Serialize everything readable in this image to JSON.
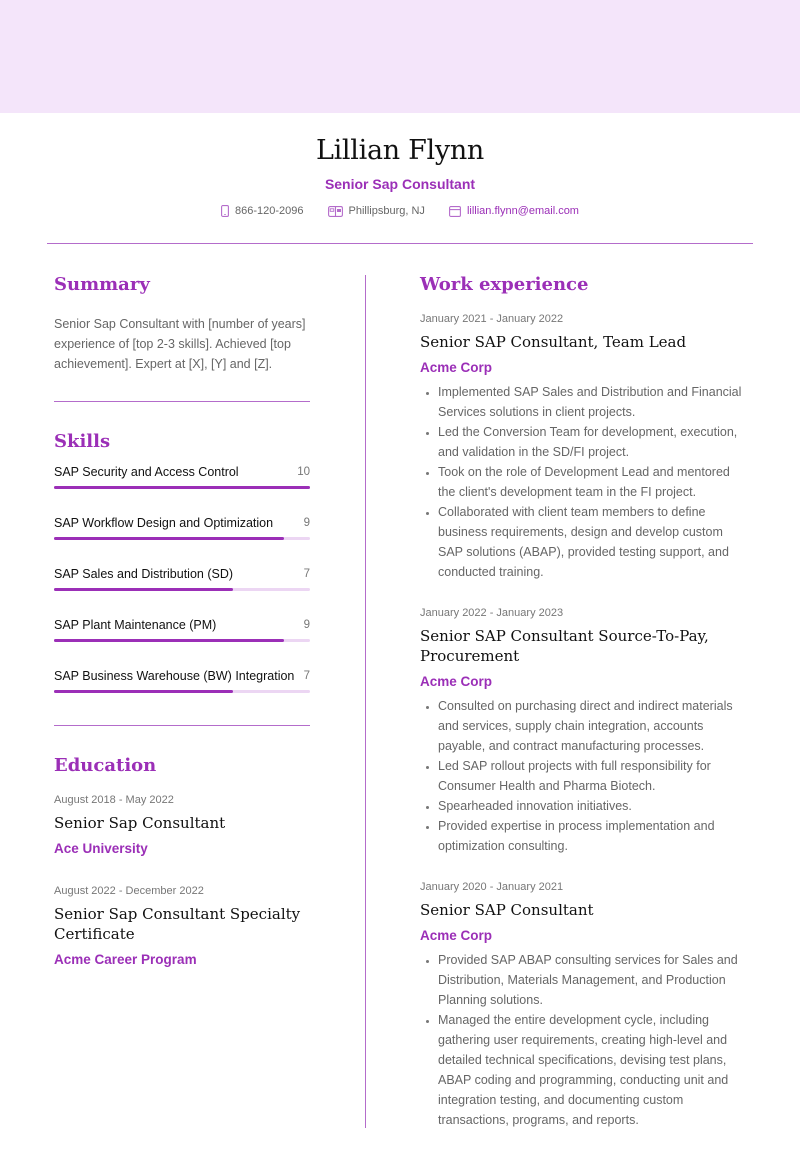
{
  "header": {
    "name": "Lillian Flynn",
    "title": "Senior Sap Consultant",
    "contacts": {
      "phone": "866-120-2096",
      "location": "Phillipsburg, NJ",
      "email": "lillian.flynn@email.com"
    }
  },
  "colors": {
    "accent": "#9b2fb7",
    "band": "#f4e5fa",
    "track": "#ecd6f3"
  },
  "summary": {
    "heading": "Summary",
    "text": "Senior Sap Consultant with [number of years] experience of [top 2-3 skills]. Achieved [top achievement]. Expert at [X], [Y] and [Z]."
  },
  "skills": {
    "heading": "Skills",
    "max": 10,
    "items": [
      {
        "label": "SAP Security and Access Control",
        "value": 10
      },
      {
        "label": "SAP Workflow Design and Optimization",
        "value": 9
      },
      {
        "label": "SAP Sales and Distribution (SD)",
        "value": 7
      },
      {
        "label": "SAP Plant Maintenance (PM)",
        "value": 9
      },
      {
        "label": "SAP Business Warehouse (BW) Integration",
        "value": 7
      }
    ]
  },
  "education": {
    "heading": "Education",
    "items": [
      {
        "dates": "August 2018 - May 2022",
        "degree": "Senior Sap Consultant",
        "school": "Ace University"
      },
      {
        "dates": "August 2022 - December 2022",
        "degree": "Senior Sap Consultant Specialty Certificate",
        "school": "Acme Career Program"
      }
    ]
  },
  "work": {
    "heading": "Work experience",
    "jobs": [
      {
        "dates": "January 2021 - January 2022",
        "role": "Senior SAP Consultant, Team Lead",
        "company": "Acme Corp",
        "bullets": [
          "Implemented SAP Sales and Distribution and Financial Services solutions in client projects.",
          "Led the Conversion Team for development, execution, and validation in the SD/FI project.",
          "Took on the role of Development Lead and mentored the client's development team in the FI project.",
          "Collaborated with client team members to define business requirements, design and develop custom SAP solutions (ABAP), provided testing support, and conducted training."
        ]
      },
      {
        "dates": "January 2022 - January 2023",
        "role": "Senior SAP Consultant Source-To-Pay, Procurement",
        "company": "Acme Corp",
        "bullets": [
          "Consulted on purchasing direct and indirect materials and services, supply chain integration, accounts payable, and contract manufacturing processes.",
          "Led SAP rollout projects with full responsibility for Consumer Health and Pharma Biotech.",
          "Spearheaded innovation initiatives.",
          "Provided expertise in process implementation and optimization consulting."
        ]
      },
      {
        "dates": "January 2020 - January 2021",
        "role": "Senior SAP Consultant",
        "company": "Acme Corp",
        "bullets": [
          "Provided SAP ABAP consulting services for Sales and Distribution, Materials Management, and Production Planning solutions.",
          "Managed the entire development cycle, including gathering user requirements, creating high-level and detailed technical specifications, devising test plans, ABAP coding and programming, conducting unit and integration testing, and documenting custom transactions, programs, and reports."
        ]
      }
    ]
  }
}
